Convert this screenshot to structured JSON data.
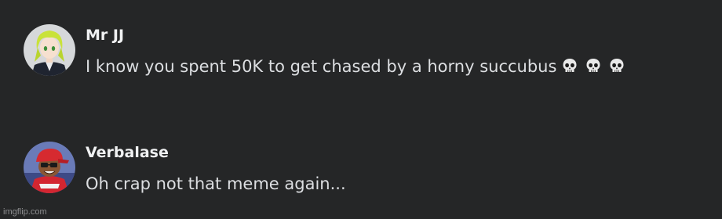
{
  "messages": [
    {
      "username": "Mr JJ",
      "text": "I know you spent 50K to get chased by a horny succubus",
      "emojis": [
        "skull-emoji",
        "skull-emoji",
        "skull-emoji"
      ]
    },
    {
      "username": "Verbalase",
      "text": "Oh crap not that meme again..."
    }
  ],
  "watermark": "imgflip.com",
  "colors": {
    "background": "#252627",
    "username": "#f0f1f2",
    "message_text": "#dcdee1",
    "watermark": "#8e8f91"
  }
}
